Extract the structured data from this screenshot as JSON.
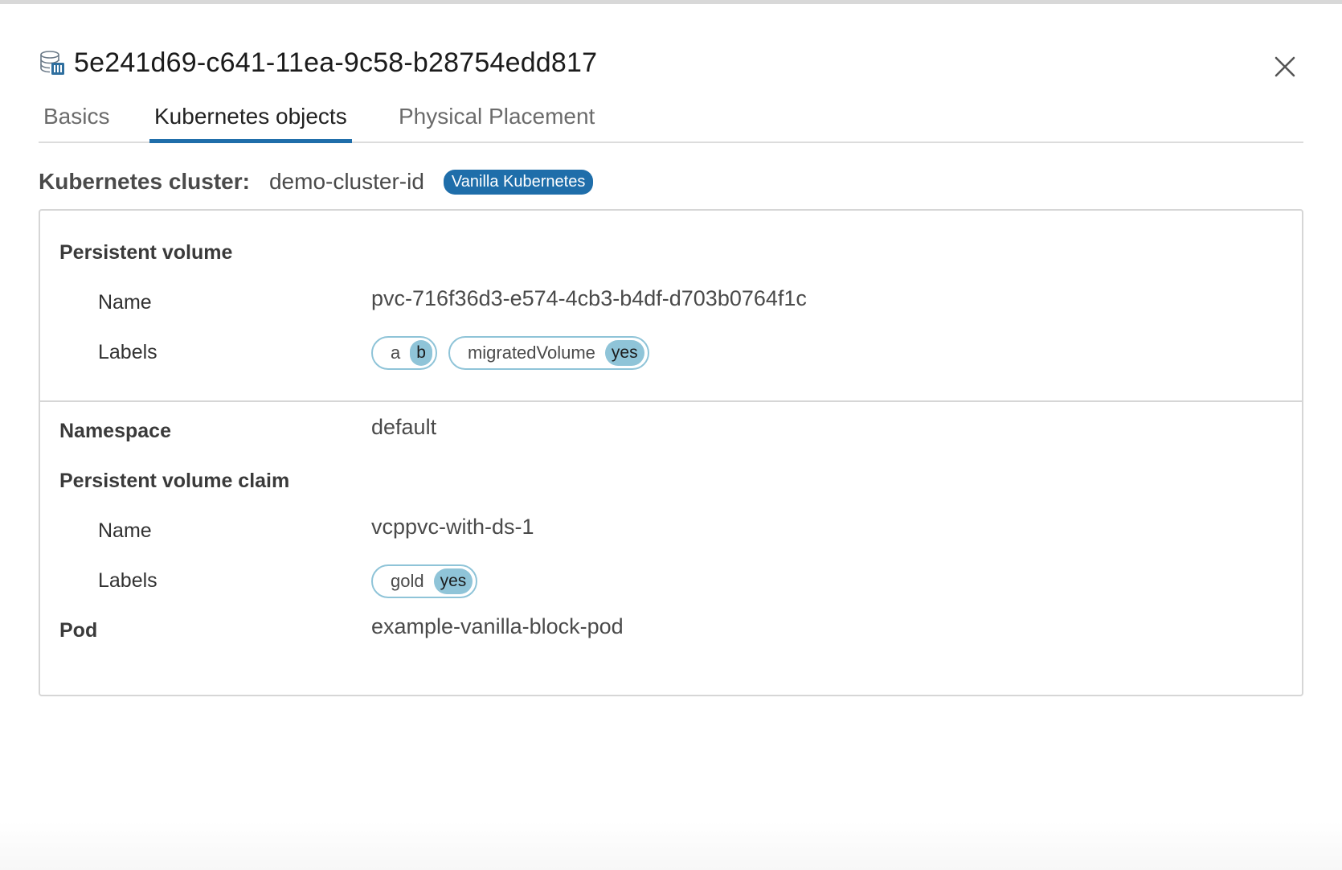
{
  "header": {
    "title": "5e241d69-c641-11ea-9c58-b28754edd817",
    "icon": "volume-database-icon",
    "close_icon": "close-icon"
  },
  "tabs": [
    {
      "label": "Basics",
      "active": false
    },
    {
      "label": "Kubernetes objects",
      "active": true
    },
    {
      "label": "Physical Placement",
      "active": false
    }
  ],
  "cluster": {
    "label": "Kubernetes cluster:",
    "value": "demo-cluster-id",
    "badge": "Vanilla Kubernetes"
  },
  "persistent_volume": {
    "heading": "Persistent volume",
    "name_label": "Name",
    "name_value": "pvc-716f36d3-e574-4cb3-b4df-d703b0764f1c",
    "labels_label": "Labels",
    "labels": [
      {
        "key": "a",
        "value": "b"
      },
      {
        "key": "migratedVolume",
        "value": "yes"
      }
    ]
  },
  "namespace": {
    "label": "Namespace",
    "value": "default"
  },
  "pvc": {
    "heading": "Persistent volume claim",
    "name_label": "Name",
    "name_value": "vcppvc-with-ds-1",
    "labels_label": "Labels",
    "labels": [
      {
        "key": "gold",
        "value": "yes"
      }
    ]
  },
  "pod": {
    "label": "Pod",
    "value": "example-vanilla-block-pod"
  },
  "colors": {
    "accent": "#1f6eaa",
    "pill": "#8fc4d8",
    "border": "#d6d6d6"
  }
}
